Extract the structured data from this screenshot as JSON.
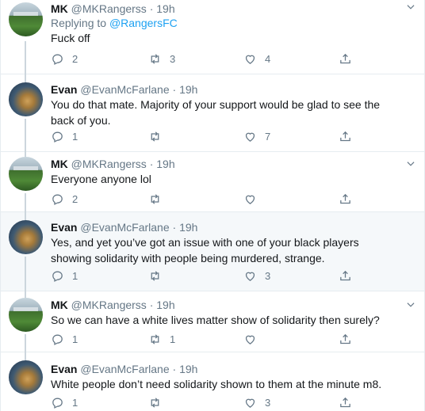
{
  "tweets": [
    {
      "name": "MK",
      "handle": "@MKRangerss",
      "time": "19h",
      "reply_prefix": "Replying to",
      "reply_target": "@RangersFC",
      "text": "Fuck off",
      "replies": "2",
      "retweets": "3",
      "likes": "4",
      "highlight": false
    },
    {
      "name": "Evan",
      "handle": "@EvanMcFarlane",
      "time": "19h",
      "text": "You do that mate. Majority of your support would be glad to see the back of you.",
      "replies": "1",
      "retweets": "",
      "likes": "7",
      "highlight": false
    },
    {
      "name": "MK",
      "handle": "@MKRangerss",
      "time": "19h",
      "text": "Everyone anyone lol",
      "replies": "2",
      "retweets": "",
      "likes": "",
      "highlight": false
    },
    {
      "name": "Evan",
      "handle": "@EvanMcFarlane",
      "time": "19h",
      "text": "Yes, and yet you’ve got an issue with one of your black players showing solidarity with people being murdered, strange.",
      "replies": "1",
      "retweets": "",
      "likes": "3",
      "highlight": true
    },
    {
      "name": "MK",
      "handle": "@MKRangerss",
      "time": "19h",
      "text": "So we can have a white lives matter show of solidarity then surely?",
      "replies": "1",
      "retweets": "1",
      "likes": "",
      "highlight": false
    },
    {
      "name": "Evan",
      "handle": "@EvanMcFarlane",
      "time": "19h",
      "text": "White people don’t need solidarity shown to them at the minute m8.",
      "replies": "1",
      "retweets": "",
      "likes": "3",
      "highlight": false
    }
  ],
  "separator": "·",
  "colors": {
    "link": "#1da1f2",
    "muted": "#657786",
    "highlight_bg": "#f5f8fa",
    "thread_line": "#ccd6dd"
  },
  "icons": [
    "reply-icon",
    "retweet-icon",
    "like-icon",
    "share-icon",
    "caret-down-icon"
  ]
}
